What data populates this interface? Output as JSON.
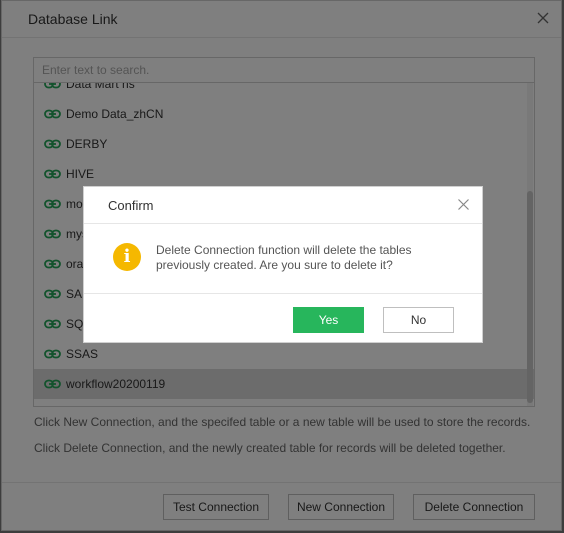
{
  "dialog": {
    "title": "Database Link",
    "search_placeholder": "Enter text to search.",
    "items": [
      {
        "label": "Data Mart hs",
        "icon": "link-icon"
      },
      {
        "label": "Demo Data_zhCN",
        "icon": "link-icon"
      },
      {
        "label": "DERBY",
        "icon": "link-icon"
      },
      {
        "label": "HIVE",
        "icon": "link-icon"
      },
      {
        "label": "mo",
        "icon": "link-icon"
      },
      {
        "label": "mys",
        "icon": "link-icon"
      },
      {
        "label": "ora",
        "icon": "link-icon"
      },
      {
        "label": "SAI",
        "icon": "link-icon"
      },
      {
        "label": "SQ",
        "icon": "link-icon"
      },
      {
        "label": "SSAS",
        "icon": "link-icon"
      },
      {
        "label": "workflow20200119",
        "icon": "link-icon",
        "selected": true
      }
    ],
    "note1": "Click New Connection, and the specifed table or a new table will be used to store the records.",
    "note2": "Click Delete Connection, and the newly created table for records will be deleted together.",
    "buttons": {
      "test": "Test Connection",
      "new": "New Connection",
      "delete": "Delete Connection"
    }
  },
  "confirm": {
    "title": "Confirm",
    "icon": "info-icon",
    "icon_glyph": "i",
    "message": "Delete Connection function will delete the tables previously created. Are you sure to delete it?",
    "yes": "Yes",
    "no": "No"
  },
  "colors": {
    "link_icon": "#27a65a",
    "yes_button": "#27b65c",
    "info_icon": "#f5b800",
    "selected_row": "#d9d9d9"
  }
}
